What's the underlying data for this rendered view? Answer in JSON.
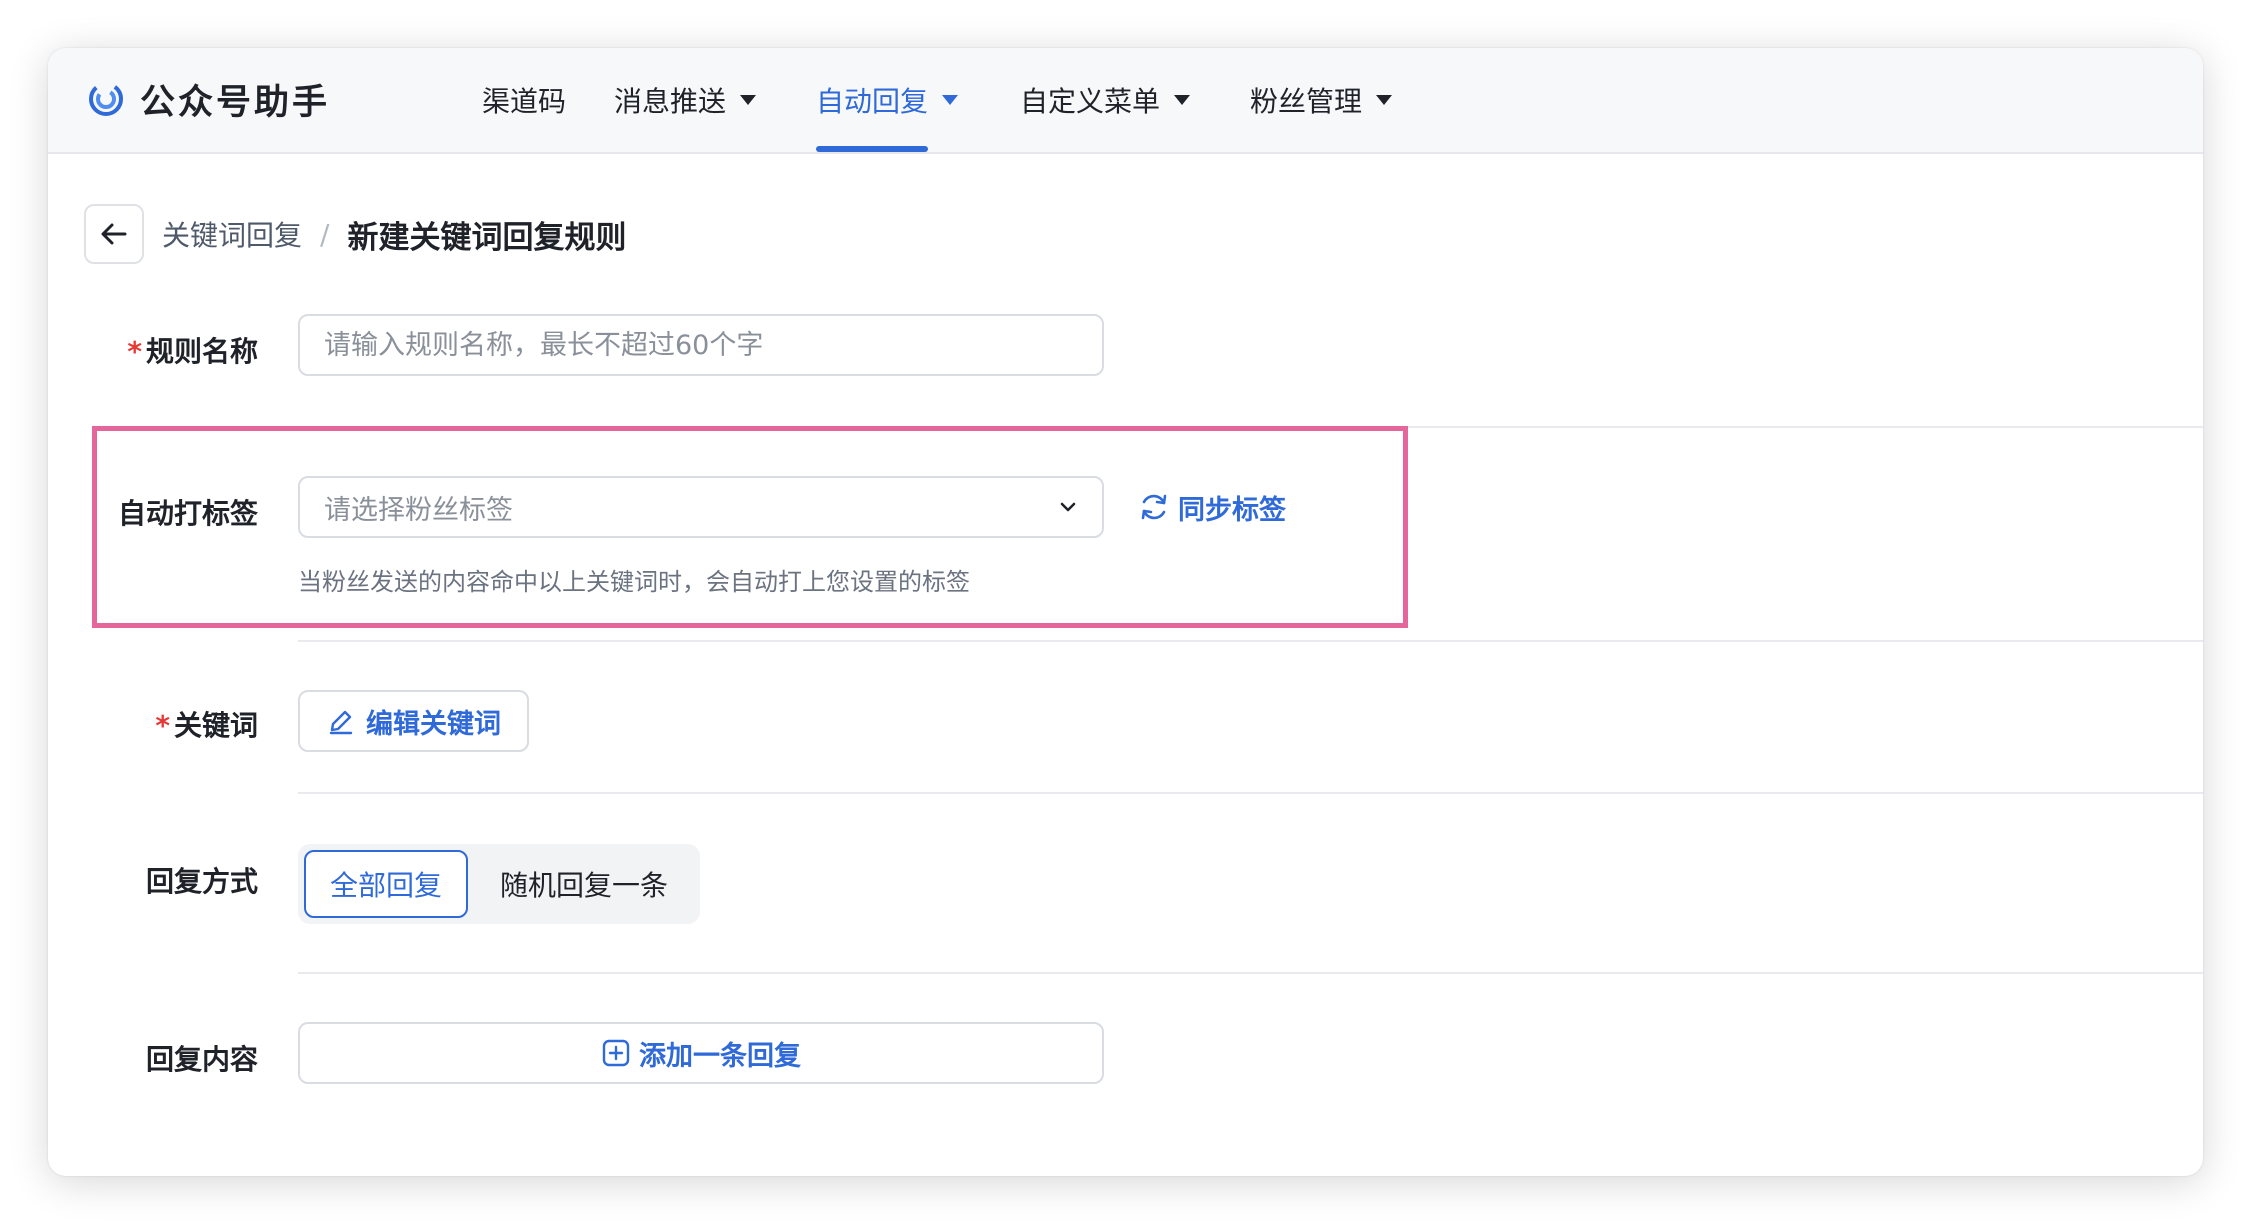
{
  "app": {
    "name": "公众号助手"
  },
  "nav": {
    "items": [
      {
        "label": "渠道码",
        "has_dropdown": false
      },
      {
        "label": "消息推送",
        "has_dropdown": true
      },
      {
        "label": "自动回复",
        "has_dropdown": true,
        "active": true
      },
      {
        "label": "自定义菜单",
        "has_dropdown": true
      },
      {
        "label": "粉丝管理",
        "has_dropdown": true
      }
    ]
  },
  "breadcrumb": {
    "parent": "关键词回复",
    "separator": "/",
    "current": "新建关键词回复规则"
  },
  "form": {
    "rule_name": {
      "required": true,
      "label": "规则名称",
      "placeholder": "请输入规则名称，最长不超过60个字",
      "value": ""
    },
    "auto_tag": {
      "label": "自动打标签",
      "placeholder": "请选择粉丝标签",
      "sync_label": "同步标签",
      "hint": "当粉丝发送的内容命中以上关键词时，会自动打上您设置的标签"
    },
    "keyword": {
      "required": true,
      "label": "关键词",
      "edit_label": "编辑关键词"
    },
    "reply_mode": {
      "label": "回复方式",
      "options": [
        "全部回复",
        "随机回复一条"
      ],
      "selected": "全部回复"
    },
    "reply_content": {
      "label": "回复内容",
      "add_label": "添加一条回复"
    }
  },
  "colors": {
    "accent": "#2f6ad8",
    "required": "#e53935",
    "highlight": "#e5669a"
  },
  "icons": {
    "logo": "brand-swirl-icon",
    "back": "arrow-left-icon",
    "select": "chevron-down-icon",
    "sync": "refresh-icon",
    "edit": "pencil-icon",
    "add": "plus-square-icon"
  }
}
